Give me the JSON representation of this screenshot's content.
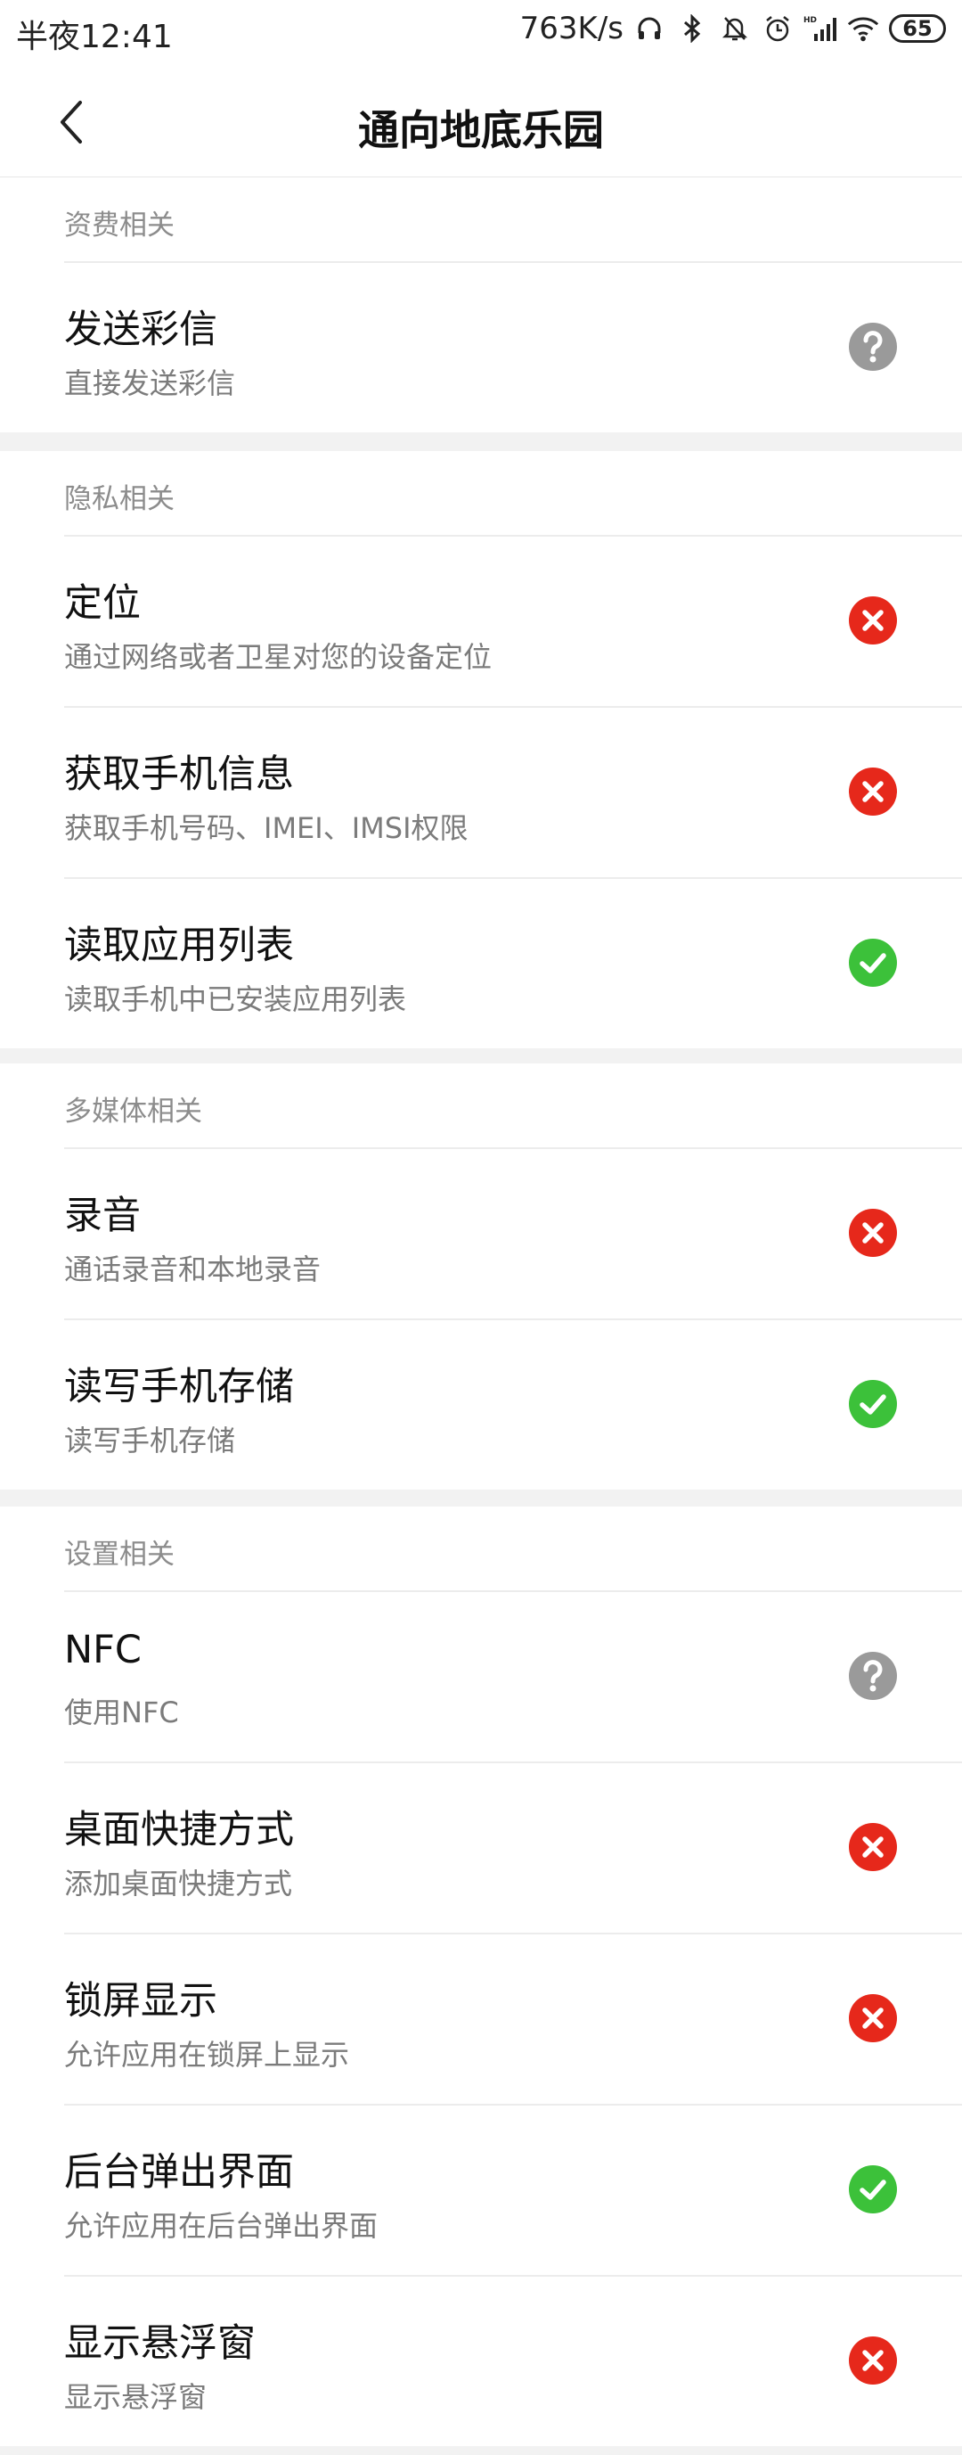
{
  "status_bar": {
    "time": "半夜12:41",
    "network_speed": "763K/s",
    "battery": "65",
    "icons": [
      "headphones-icon",
      "bluetooth-icon",
      "mute-bell-icon",
      "alarm-icon",
      "hd-signal-icon",
      "wifi-icon",
      "battery-icon"
    ]
  },
  "header": {
    "title": "通向地底乐园",
    "back_icon": "back-chevron-icon"
  },
  "colors": {
    "deny": "#e6281b",
    "allow": "#3cc13a",
    "unknown": "#9a9a9a"
  },
  "sections": [
    {
      "title": "资费相关",
      "items": [
        {
          "title": "发送彩信",
          "subtitle": "直接发送彩信",
          "status": "unknown"
        }
      ]
    },
    {
      "title": "隐私相关",
      "items": [
        {
          "title": "定位",
          "subtitle": "通过网络或者卫星对您的设备定位",
          "status": "deny"
        },
        {
          "title": "获取手机信息",
          "subtitle": "获取手机号码、IMEI、IMSI权限",
          "status": "deny"
        },
        {
          "title": "读取应用列表",
          "subtitle": "读取手机中已安装应用列表",
          "status": "allow"
        }
      ]
    },
    {
      "title": "多媒体相关",
      "items": [
        {
          "title": "录音",
          "subtitle": "通话录音和本地录音",
          "status": "deny"
        },
        {
          "title": "读写手机存储",
          "subtitle": "读写手机存储",
          "status": "allow"
        }
      ]
    },
    {
      "title": "设置相关",
      "items": [
        {
          "title": "NFC",
          "subtitle": "使用NFC",
          "status": "unknown"
        },
        {
          "title": "桌面快捷方式",
          "subtitle": "添加桌面快捷方式",
          "status": "deny"
        },
        {
          "title": "锁屏显示",
          "subtitle": "允许应用在锁屏上显示",
          "status": "deny"
        },
        {
          "title": "后台弹出界面",
          "subtitle": "允许应用在后台弹出界面",
          "status": "allow"
        },
        {
          "title": "显示悬浮窗",
          "subtitle": "显示悬浮窗",
          "status": "deny"
        }
      ]
    }
  ]
}
